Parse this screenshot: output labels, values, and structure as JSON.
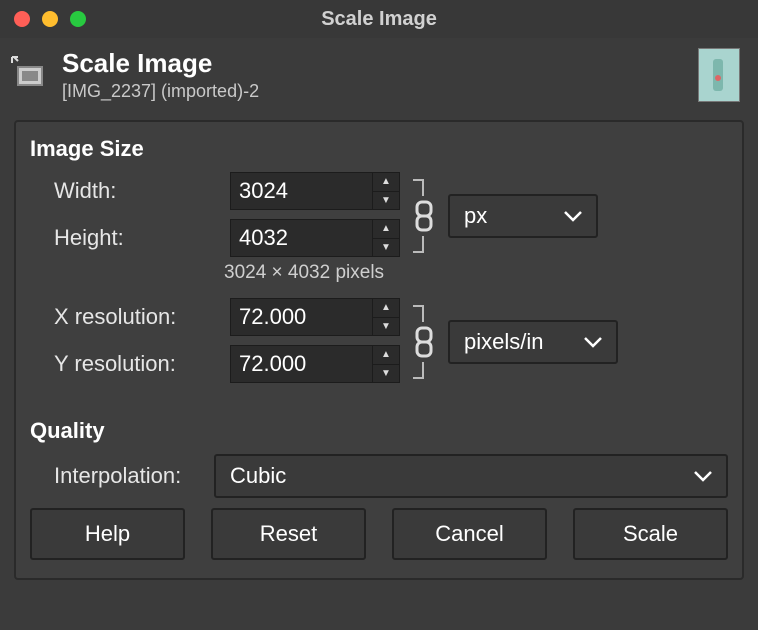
{
  "titlebar": {
    "title": "Scale Image"
  },
  "header": {
    "title": "Scale Image",
    "subtitle": "[IMG_2237] (imported)-2"
  },
  "sections": {
    "image_size_title": "Image Size",
    "quality_title": "Quality"
  },
  "size": {
    "width_label": "Width:",
    "width_value": "3024",
    "height_label": "Height:",
    "height_value": "4032",
    "hint": "3024 × 4032 pixels",
    "unit_selected": "px"
  },
  "resolution": {
    "x_label": "X resolution:",
    "x_value": "72.000",
    "y_label": "Y resolution:",
    "y_value": "72.000",
    "unit_selected": "pixels/in"
  },
  "interpolation": {
    "label": "Interpolation:",
    "selected": "Cubic"
  },
  "buttons": {
    "help": "Help",
    "reset": "Reset",
    "cancel": "Cancel",
    "scale": "Scale"
  }
}
